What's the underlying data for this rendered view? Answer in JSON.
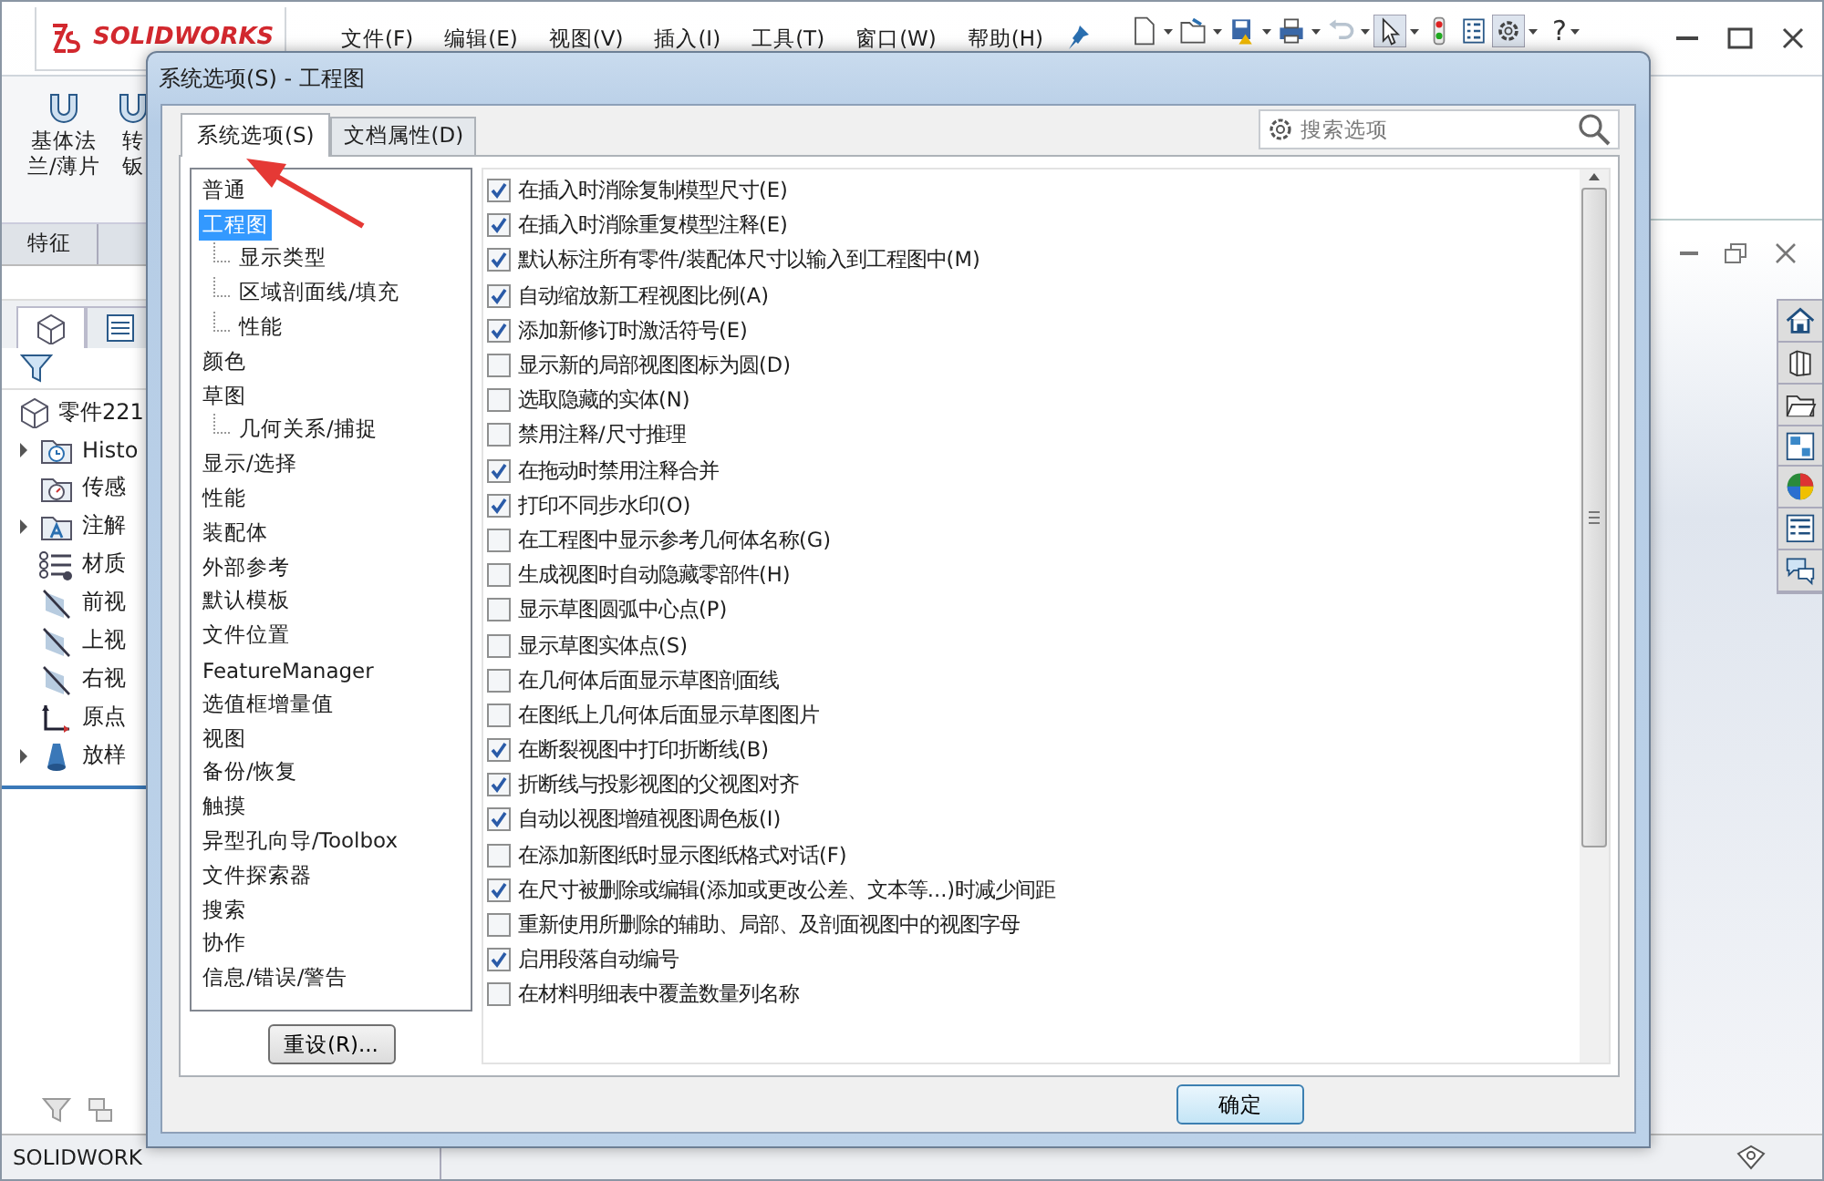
{
  "app": {
    "logo": "SOLIDWORKS",
    "menus": [
      "文件(F)",
      "编辑(E)",
      "视图(V)",
      "插入(I)",
      "工具(T)",
      "窗口(W)",
      "帮助(H)"
    ],
    "help_glyph": "?",
    "command_buttons": [
      {
        "lines": [
          "基体法",
          "兰/薄片"
        ]
      },
      {
        "lines": [
          "转",
          "钣"
        ]
      }
    ],
    "manager_tabs": [
      "特征"
    ],
    "feature_tree": {
      "root": "零件221",
      "items": [
        {
          "label": "Histo",
          "kind": "history",
          "expandable": true
        },
        {
          "label": "传感",
          "kind": "sensor",
          "expandable": false
        },
        {
          "label": "注解",
          "kind": "annotation",
          "expandable": true
        },
        {
          "label": "材质",
          "kind": "material",
          "expandable": false
        },
        {
          "label": "前视",
          "kind": "plane",
          "expandable": false
        },
        {
          "label": "上视",
          "kind": "plane",
          "expandable": false
        },
        {
          "label": "右视",
          "kind": "plane",
          "expandable": false
        },
        {
          "label": "原点",
          "kind": "origin",
          "expandable": false
        },
        {
          "label": "放样",
          "kind": "loft",
          "expandable": true
        }
      ]
    },
    "status_bar": "SOLIDWORK"
  },
  "dialog": {
    "title": "系统选项(S) - 工程图",
    "tabs": [
      {
        "label": "系统选项(S)",
        "selected": true
      },
      {
        "label": "文档属性(D)",
        "selected": false
      }
    ],
    "search": {
      "placeholder": "搜索选项"
    },
    "categories": [
      {
        "label": "普通",
        "selected": false
      },
      {
        "label": "工程图",
        "selected": true,
        "children": [
          {
            "label": "显示类型",
            "selected": false
          },
          {
            "label": "区域剖面线/填充",
            "selected": false
          },
          {
            "label": "性能",
            "selected": false
          }
        ]
      },
      {
        "label": "颜色",
        "selected": false
      },
      {
        "label": "草图",
        "selected": false,
        "children": [
          {
            "label": "几何关系/捕捉",
            "selected": false
          }
        ]
      },
      {
        "label": "显示/选择",
        "selected": false
      },
      {
        "label": "性能",
        "selected": false
      },
      {
        "label": "装配体",
        "selected": false
      },
      {
        "label": "外部参考",
        "selected": false
      },
      {
        "label": "默认模板",
        "selected": false
      },
      {
        "label": "文件位置",
        "selected": false
      },
      {
        "label": "FeatureManager",
        "selected": false
      },
      {
        "label": "选值框增量值",
        "selected": false
      },
      {
        "label": "视图",
        "selected": false
      },
      {
        "label": "备份/恢复",
        "selected": false
      },
      {
        "label": "触摸",
        "selected": false
      },
      {
        "label": "异型孔向导/Toolbox",
        "selected": false
      },
      {
        "label": "文件探索器",
        "selected": false
      },
      {
        "label": "搜索",
        "selected": false
      },
      {
        "label": "协作",
        "selected": false
      },
      {
        "label": "信息/错误/警告",
        "selected": false
      }
    ],
    "reset_button": "重设(R)...",
    "options": [
      {
        "label": "在插入时消除复制模型尺寸(E)",
        "checked": true
      },
      {
        "label": "在插入时消除重复模型注释(E)",
        "checked": true
      },
      {
        "label": "默认标注所有零件/装配体尺寸以输入到工程图中(M)",
        "checked": true
      },
      {
        "label": "自动缩放新工程视图比例(A)",
        "checked": true
      },
      {
        "label": "添加新修订时激活符号(E)",
        "checked": true
      },
      {
        "label": "显示新的局部视图图标为圆(D)",
        "checked": false
      },
      {
        "label": "选取隐藏的实体(N)",
        "checked": false
      },
      {
        "label": "禁用注释/尺寸推理",
        "checked": false
      },
      {
        "label": "在拖动时禁用注释合并",
        "checked": true
      },
      {
        "label": "打印不同步水印(O)",
        "checked": true
      },
      {
        "label": "在工程图中显示参考几何体名称(G)",
        "checked": false
      },
      {
        "label": "生成视图时自动隐藏零部件(H)",
        "checked": false
      },
      {
        "label": "显示草图圆弧中心点(P)",
        "checked": false
      },
      {
        "label": "显示草图实体点(S)",
        "checked": false
      },
      {
        "label": "在几何体后面显示草图剖面线",
        "checked": false
      },
      {
        "label": "在图纸上几何体后面显示草图图片",
        "checked": false
      },
      {
        "label": "在断裂视图中打印折断线(B)",
        "checked": true
      },
      {
        "label": "折断线与投影视图的父视图对齐",
        "checked": true
      },
      {
        "label": "自动以视图增殖视图调色板(I)",
        "checked": true
      },
      {
        "label": "在添加新图纸时显示图纸格式对话(F)",
        "checked": false
      },
      {
        "label": "在尺寸被删除或编辑(添加或更改公差、文本等...)时减少间距",
        "checked": true
      },
      {
        "label": "重新使用所删除的辅助、局部、及剖面视图中的视图字母",
        "checked": false
      },
      {
        "label": "启用段落自动编号",
        "checked": true
      },
      {
        "label": "在材料明细表中覆盖数量列名称",
        "checked": false
      }
    ],
    "ok_button": "确定"
  }
}
